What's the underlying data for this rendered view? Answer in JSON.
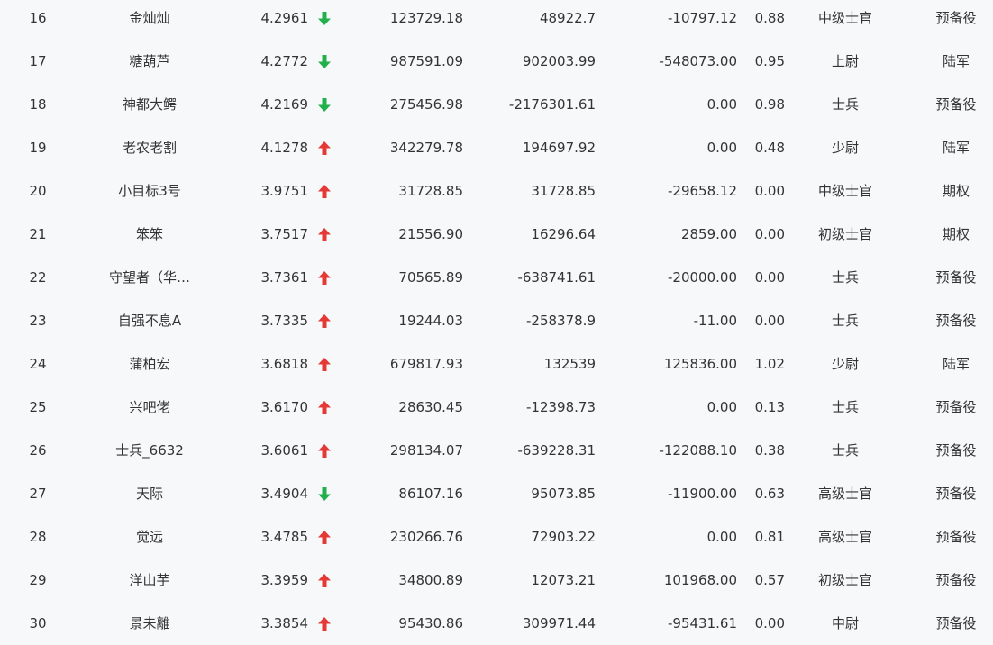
{
  "colors": {
    "up": "#e53935",
    "down": "#21b04b",
    "text": "#333333",
    "background": "#f7f8fa"
  },
  "rows": [
    {
      "rank": "16",
      "name": "金灿灿",
      "score": "4.2961",
      "trend": "down",
      "value1": "123729.18",
      "value2": "48922.7",
      "value3": "-10797.12",
      "ratio": "0.88",
      "level": "中级士官",
      "category": "预备役"
    },
    {
      "rank": "17",
      "name": "糖葫芦",
      "score": "4.2772",
      "trend": "down",
      "value1": "987591.09",
      "value2": "902003.99",
      "value3": "-548073.00",
      "ratio": "0.95",
      "level": "上尉",
      "category": "陆军"
    },
    {
      "rank": "18",
      "name": "神都大鳄",
      "score": "4.2169",
      "trend": "down",
      "value1": "275456.98",
      "value2": "-2176301.61",
      "value3": "0.00",
      "ratio": "0.98",
      "level": "士兵",
      "category": "预备役"
    },
    {
      "rank": "19",
      "name": "老农老割",
      "score": "4.1278",
      "trend": "up",
      "value1": "342279.78",
      "value2": "194697.92",
      "value3": "0.00",
      "ratio": "0.48",
      "level": "少尉",
      "category": "陆军"
    },
    {
      "rank": "20",
      "name": "小目标3号",
      "score": "3.9751",
      "trend": "up",
      "value1": "31728.85",
      "value2": "31728.85",
      "value3": "-29658.12",
      "ratio": "0.00",
      "level": "中级士官",
      "category": "期权"
    },
    {
      "rank": "21",
      "name": "笨笨",
      "score": "3.7517",
      "trend": "up",
      "value1": "21556.90",
      "value2": "16296.64",
      "value3": "2859.00",
      "ratio": "0.00",
      "level": "初级士官",
      "category": "期权"
    },
    {
      "rank": "22",
      "name": "守望者（华…",
      "score": "3.7361",
      "trend": "up",
      "value1": "70565.89",
      "value2": "-638741.61",
      "value3": "-20000.00",
      "ratio": "0.00",
      "level": "士兵",
      "category": "预备役"
    },
    {
      "rank": "23",
      "name": "自强不息A",
      "score": "3.7335",
      "trend": "up",
      "value1": "19244.03",
      "value2": "-258378.9",
      "value3": "-11.00",
      "ratio": "0.00",
      "level": "士兵",
      "category": "预备役"
    },
    {
      "rank": "24",
      "name": "蒲柏宏",
      "score": "3.6818",
      "trend": "up",
      "value1": "679817.93",
      "value2": "132539",
      "value3": "125836.00",
      "ratio": "1.02",
      "level": "少尉",
      "category": "陆军"
    },
    {
      "rank": "25",
      "name": "兴吧佬",
      "score": "3.6170",
      "trend": "up",
      "value1": "28630.45",
      "value2": "-12398.73",
      "value3": "0.00",
      "ratio": "0.13",
      "level": "士兵",
      "category": "预备役"
    },
    {
      "rank": "26",
      "name": "士兵_6632",
      "score": "3.6061",
      "trend": "up",
      "value1": "298134.07",
      "value2": "-639228.31",
      "value3": "-122088.10",
      "ratio": "0.38",
      "level": "士兵",
      "category": "预备役"
    },
    {
      "rank": "27",
      "name": "天际",
      "score": "3.4904",
      "trend": "down",
      "value1": "86107.16",
      "value2": "95073.85",
      "value3": "-11900.00",
      "ratio": "0.63",
      "level": "高级士官",
      "category": "预备役"
    },
    {
      "rank": "28",
      "name": "觉远",
      "score": "3.4785",
      "trend": "up",
      "value1": "230266.76",
      "value2": "72903.22",
      "value3": "0.00",
      "ratio": "0.81",
      "level": "高级士官",
      "category": "预备役"
    },
    {
      "rank": "29",
      "name": "洋山芋",
      "score": "3.3959",
      "trend": "up",
      "value1": "34800.89",
      "value2": "12073.21",
      "value3": "101968.00",
      "ratio": "0.57",
      "level": "初级士官",
      "category": "预备役"
    },
    {
      "rank": "30",
      "name": "景未離",
      "score": "3.3854",
      "trend": "up",
      "value1": "95430.86",
      "value2": "309971.44",
      "value3": "-95431.61",
      "ratio": "0.00",
      "level": "中尉",
      "category": "预备役"
    }
  ]
}
